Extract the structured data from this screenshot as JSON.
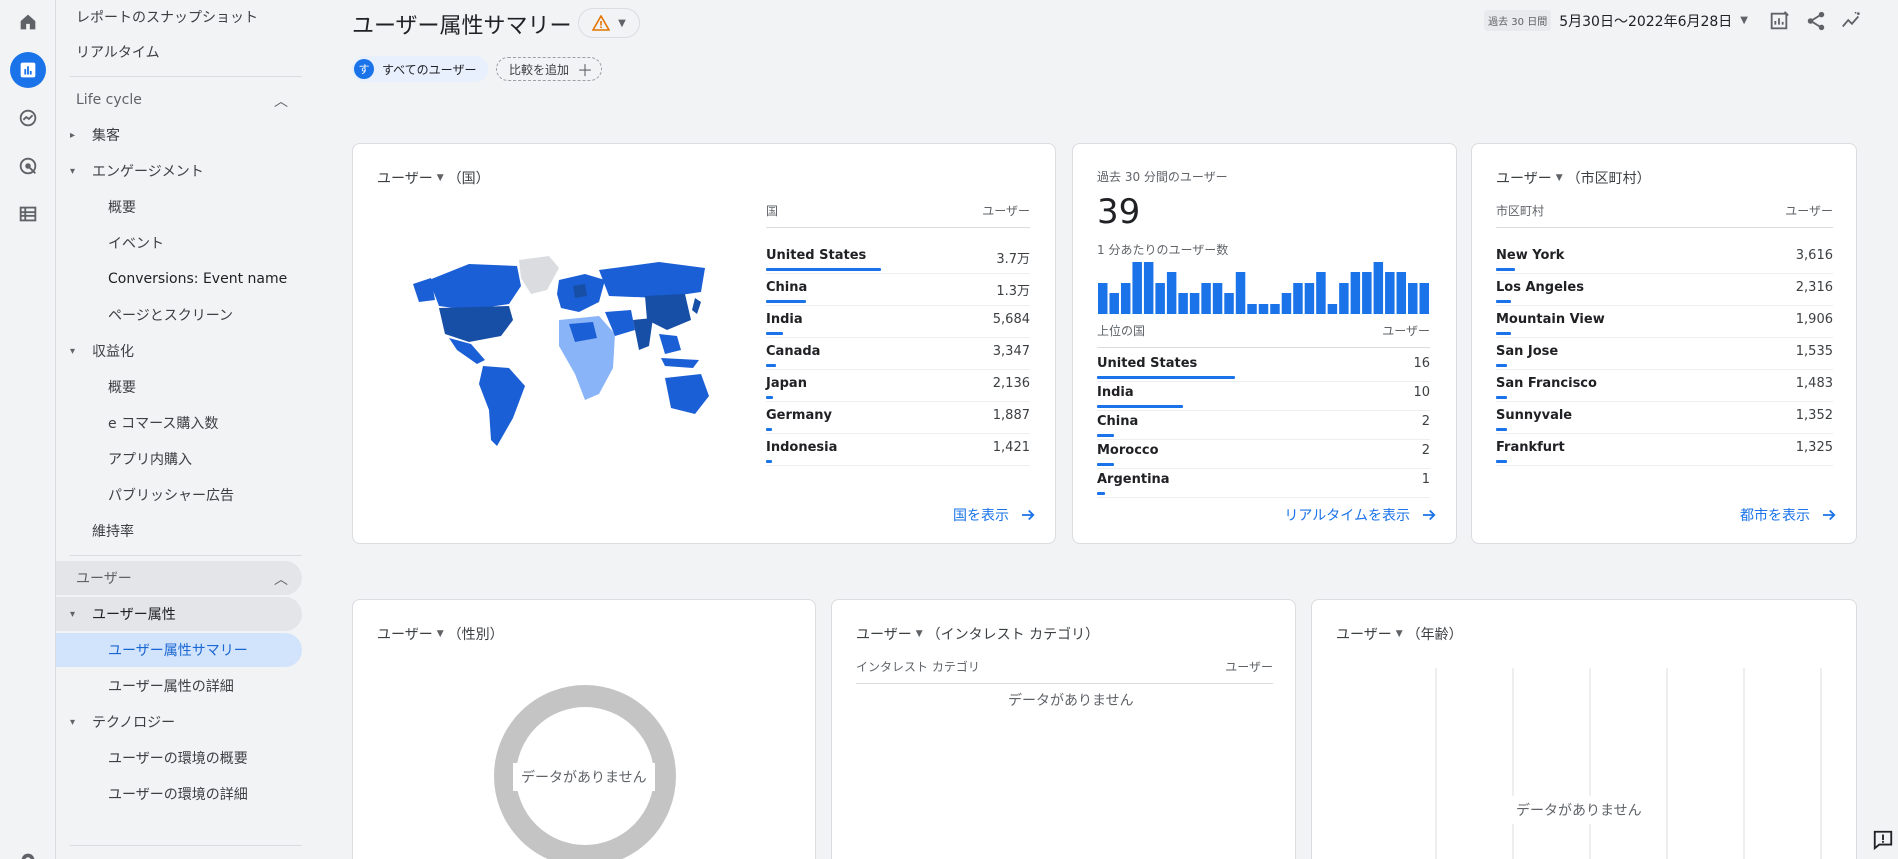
{
  "rail": {
    "icons": [
      "home-icon",
      "reports-icon",
      "explore-icon",
      "advertising-icon",
      "configure-icon",
      "settings-icon"
    ]
  },
  "nav": {
    "top_items": [
      "レポートのスナップショット",
      "リアルタイム"
    ],
    "lifecycle_title": "Life cycle",
    "acquisition": "集客",
    "engagement": "エンゲージメント",
    "engagement_items": [
      "概要",
      "イベント",
      "Conversions: Event name",
      "ページとスクリーン"
    ],
    "monetization": "収益化",
    "monetization_items": [
      "概要",
      "e コマース購入数",
      "アプリ内購入",
      "パブリッシャー広告"
    ],
    "retention": "維持率",
    "user_title": "ユーザー",
    "demographics": "ユーザー属性",
    "demographics_items": [
      "ユーザー属性サマリー",
      "ユーザー属性の詳細"
    ],
    "tech": "テクノロジー",
    "tech_items": [
      "ユーザーの環境の概要",
      "ユーザーの環境の詳細"
    ]
  },
  "header": {
    "title": "ユーザー属性サマリー",
    "date_badge": "過去 30 日間",
    "date_range": "5月30日〜2022年6月28日"
  },
  "filters": {
    "all_users_initial": "す",
    "all_users": "すべてのユーザー",
    "add_compare": "比較を追加"
  },
  "country_card": {
    "metric": "ユーザー",
    "dim": "（国）",
    "col_name": "国",
    "col_value": "ユーザー",
    "rows": [
      {
        "name": "United States",
        "value": "3.7万",
        "share": 1.0
      },
      {
        "name": "China",
        "value": "1.3万",
        "share": 0.35
      },
      {
        "name": "India",
        "value": "5,684",
        "share": 0.15
      },
      {
        "name": "Canada",
        "value": "3,347",
        "share": 0.09
      },
      {
        "name": "Japan",
        "value": "2,136",
        "share": 0.06
      },
      {
        "name": "Germany",
        "value": "1,887",
        "share": 0.05
      },
      {
        "name": "Indonesia",
        "value": "1,421",
        "share": 0.04
      }
    ],
    "link": "国を表示"
  },
  "realtime_card": {
    "title": "過去 30 分間のユーザー",
    "count": "39",
    "per_minute_label": "1 分あたりのユーザー数",
    "per_minute": [
      3,
      2,
      3,
      5,
      5,
      3,
      4,
      2,
      2,
      3,
      3,
      2,
      4,
      1,
      1,
      1,
      2,
      3,
      3,
      4,
      1,
      3,
      4,
      4,
      5,
      4,
      4,
      3,
      3
    ],
    "col_name": "上位の国",
    "col_value": "ユーザー",
    "rows": [
      {
        "name": "United States",
        "value": "16",
        "share": 1.0
      },
      {
        "name": "India",
        "value": "10",
        "share": 0.62
      },
      {
        "name": "China",
        "value": "2",
        "share": 0.12
      },
      {
        "name": "Morocco",
        "value": "2",
        "share": 0.12
      },
      {
        "name": "Argentina",
        "value": "1",
        "share": 0.06
      }
    ],
    "link": "リアルタイムを表示"
  },
  "city_card": {
    "metric": "ユーザー",
    "dim": "（市区町村）",
    "col_name": "市区町村",
    "col_value": "ユーザー",
    "rows": [
      {
        "name": "New York",
        "value": "3,616",
        "share": 0.05
      },
      {
        "name": "Los Angeles",
        "value": "2,316",
        "share": 0.04
      },
      {
        "name": "Mountain View",
        "value": "1,906",
        "share": 0.04
      },
      {
        "name": "San Jose",
        "value": "1,535",
        "share": 0.03
      },
      {
        "name": "San Francisco",
        "value": "1,483",
        "share": 0.03
      },
      {
        "name": "Sunnyvale",
        "value": "1,352",
        "share": 0.03
      },
      {
        "name": "Frankfurt",
        "value": "1,325",
        "share": 0.03
      }
    ],
    "link": "都市を表示"
  },
  "gender_card": {
    "metric": "ユーザー",
    "dim": "（性別）",
    "no_data": "データがありません"
  },
  "interest_card": {
    "metric": "ユーザー",
    "dim": "（インタレスト カテゴリ）",
    "col_name": "インタレスト カテゴリ",
    "col_value": "ユーザー",
    "no_data": "データがありません"
  },
  "age_card": {
    "metric": "ユーザー",
    "dim": "（年齢）",
    "no_data": "データがありません"
  },
  "colors": {
    "accent": "#1a73e8",
    "map_dark": "#174ea6",
    "map_mid": "#1a5fd6",
    "map_light": "#8ab4f8",
    "map_none": "#dadce0"
  }
}
